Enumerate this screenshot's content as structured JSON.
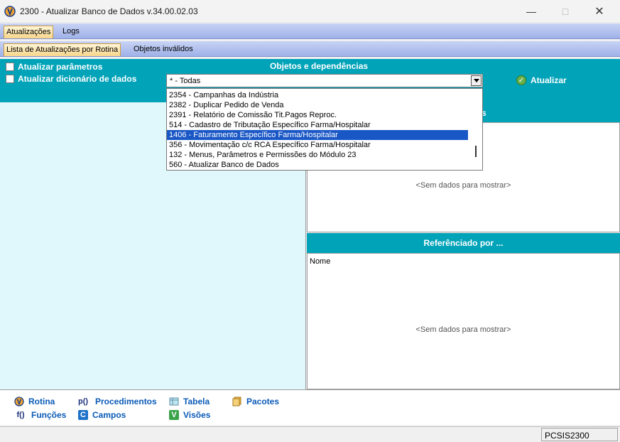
{
  "window": {
    "title": "2300 - Atualizar Banco de Dados v.34.00.02.03",
    "icon": "app-logo-icon",
    "controls": {
      "minimize": "—",
      "maximize": "□",
      "close": "✕"
    }
  },
  "tabs_main": [
    {
      "label": "Atualizações",
      "active": true
    },
    {
      "label": "Logs",
      "active": false
    }
  ],
  "tabs_sub": [
    {
      "label": "Lista de Atualizações por Rotina",
      "active": true
    },
    {
      "label": "Objetos inválidos",
      "active": false
    }
  ],
  "header": {
    "atualizar_parametros": "Atualizar parâmetros",
    "atualizar_dicionario": "Atualizar dicionário de dados",
    "section_title": "Objetos e dependências",
    "atualizar_button": "Atualizar"
  },
  "combo": {
    "selected": "* - Todas",
    "options": [
      "2354 - Campanhas da Indústria",
      "2382 - Duplicar Pedido de Venda",
      "2391 - Relatório de Comissão Tit.Pagos Reproc.",
      "514 - Cadastro de Tributação Específico Farma/Hospitalar",
      "1406 - Faturamento Específico Farma/Hospitalar",
      "356 - Movimentação c/c RCA Específico Farma/Hospitalar",
      "132 - Menus, Parâmetros e Permissões do Módulo 23",
      "560 - Atualizar Banco de Dados"
    ],
    "highlighted_index": 4
  },
  "deps_panel": {
    "title_visible_fragment": "s",
    "empty_text": "<Sem dados para mostrar>"
  },
  "ref_panel": {
    "title": "Referênciado por ...",
    "column": "Nome",
    "empty_text": "<Sem dados para mostrar>"
  },
  "legend": {
    "rotina": "Rotina",
    "procedimentos": "Procedimentos",
    "tabela": "Tabela",
    "pacotes": "Pacotes",
    "funcoes": "Funções",
    "campos": "Campos",
    "visoes": "Visões",
    "icons": {
      "procedimentos": "p()",
      "funcoes": "f()",
      "campos": "C",
      "visoes": "V"
    }
  },
  "status": {
    "code": "PCSIS2300"
  },
  "colors": {
    "teal": "#00a3b8",
    "selection": "#1a57c6",
    "legend_text": "#0a5ab8"
  }
}
